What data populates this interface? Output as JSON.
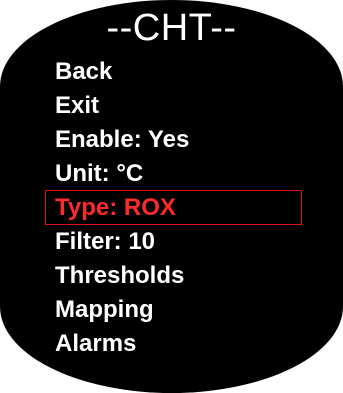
{
  "screen": {
    "title": "--CHT--"
  },
  "menu": {
    "items": [
      {
        "label": "Back"
      },
      {
        "label": "Exit"
      },
      {
        "label": "Enable: Yes"
      },
      {
        "label": "Unit: °C"
      },
      {
        "label": "Type: ROX",
        "selected": true
      },
      {
        "label": "Filter: 10"
      },
      {
        "label": "Thresholds"
      },
      {
        "label": "Mapping"
      },
      {
        "label": "Alarms"
      }
    ]
  },
  "colors": {
    "background": "#000000",
    "text": "#ffffff",
    "highlight_text": "#ff2a2a",
    "highlight_border": "#e01010"
  }
}
